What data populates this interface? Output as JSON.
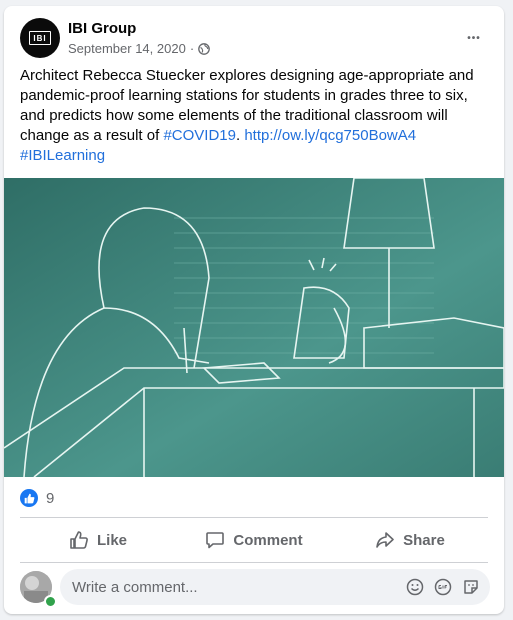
{
  "post": {
    "page_name": "IBI Group",
    "avatar_text": "IBI",
    "date": "September 14, 2020",
    "separator": "·",
    "more_label": "•••",
    "text_main": "Architect Rebecca Stuecker explores designing age-appropriate and pandemic-proof learning stations for students in grades three to six, and predicts how some elements of the traditional classroom will change as a result of ",
    "hashtag_covid": "#COVID19",
    "text_period": ". ",
    "link": "http://ow.ly/qcg750BowA4",
    "hashtag_ibi": "#IBILearning"
  },
  "reactions": {
    "count": "9"
  },
  "actions": {
    "like": "Like",
    "comment": "Comment",
    "share": "Share"
  },
  "comment": {
    "placeholder": "Write a comment..."
  },
  "colors": {
    "brand_blue": "#1877f2",
    "link_blue": "#216fdb",
    "image_teal": "#4a8f86"
  }
}
